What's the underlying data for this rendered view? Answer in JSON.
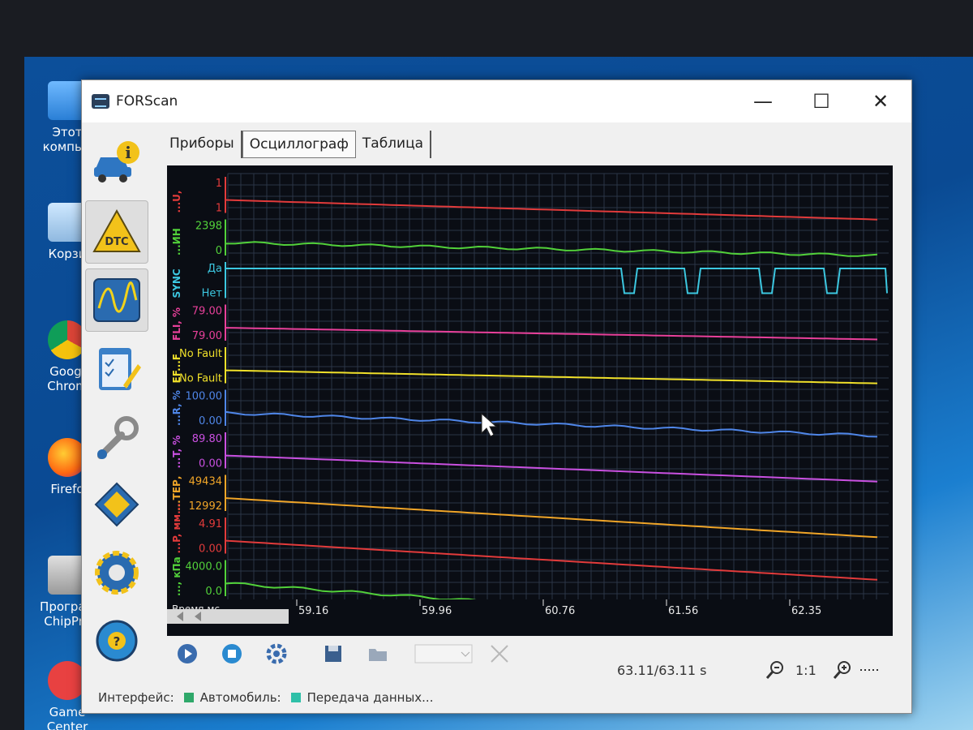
{
  "desktop": {
    "icons": [
      {
        "label": "Этот компью"
      },
      {
        "label": "Корзи"
      },
      {
        "label": "Googl Chrom"
      },
      {
        "label": "Firefo"
      },
      {
        "label": "Програм ChipPro"
      },
      {
        "label": "Game Center"
      }
    ]
  },
  "window": {
    "title": "FORScan",
    "controls": {
      "minimize": "—",
      "maximize": "☐",
      "close": "✕"
    }
  },
  "sidebar": {
    "items": [
      {
        "name": "info",
        "icon": "car-info-icon"
      },
      {
        "name": "dtc",
        "icon": "dtc-warning-icon",
        "label": "DTC"
      },
      {
        "name": "oscilloscope",
        "icon": "waveform-icon"
      },
      {
        "name": "tests",
        "icon": "checklist-icon"
      },
      {
        "name": "service",
        "icon": "wrench-icon"
      },
      {
        "name": "config",
        "icon": "chip-icon"
      },
      {
        "name": "settings",
        "icon": "gear-icon"
      },
      {
        "name": "help",
        "icon": "help-wheel-icon",
        "label": "?"
      }
    ]
  },
  "tabs": [
    {
      "label": "Приборы",
      "active": false
    },
    {
      "label": "Осциллограф",
      "active": true
    },
    {
      "label": "Таблица",
      "active": false
    }
  ],
  "scope": {
    "channels": [
      {
        "name": "...U,",
        "top": "1",
        "bottom": "1",
        "color": "#e23b3b"
      },
      {
        "name": "...ИН",
        "top": "2398",
        "bottom": "0",
        "color": "#52d13a"
      },
      {
        "name": "SYNC",
        "top": "Да",
        "bottom": "Нет",
        "color": "#3cc7e0"
      },
      {
        "name": "FLI, %",
        "top": "79.00",
        "bottom": "79.00",
        "color": "#e8409a"
      },
      {
        "name": "EF...F",
        "top": "No Fault",
        "bottom": "No Fault",
        "color": "#f0e02a"
      },
      {
        "name": "...R, %",
        "top": "100.00",
        "bottom": "0.00",
        "color": "#4f86e8"
      },
      {
        "name": "...T, %",
        "top": "89.80",
        "bottom": "0.00",
        "color": "#c950e0"
      },
      {
        "name": "...ТЕР,",
        "top": "49434",
        "bottom": "12992",
        "color": "#f0a528"
      },
      {
        "name": "...P, мм...",
        "top": "4.91",
        "bottom": "0.00",
        "color": "#e23b3b"
      },
      {
        "name": "..., кПа",
        "top": "4000.0",
        "bottom": "0.0",
        "color": "#52d13a"
      }
    ],
    "time_axis_label": "Время,мс",
    "time_ticks": [
      "59.16",
      "59.96",
      "60.76",
      "61.56",
      "62.35"
    ]
  },
  "toolbar": {
    "time_readout": "63.11/63.11 s",
    "zoom_ratio": "1:1"
  },
  "status": {
    "interface_label": "Интерфейс:",
    "vehicle_label": "Автомобиль:",
    "transfer_label": "Передача данных..."
  }
}
